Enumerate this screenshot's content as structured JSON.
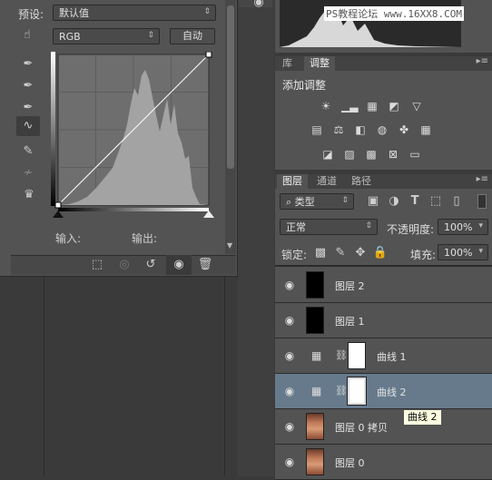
{
  "properties": {
    "preset_label": "预设:",
    "preset_value": "默认值",
    "channel_value": "RGB",
    "auto_button": "自动",
    "input_label": "输入:",
    "output_label": "输出:"
  },
  "histogram": {
    "watermark": "PS教程论坛 www.16XX8.COM"
  },
  "adjust_panel": {
    "tabs": [
      "库",
      "调整"
    ],
    "title": "添加调整"
  },
  "layers_panel": {
    "tabs": [
      "图层",
      "通道",
      "路径"
    ],
    "filter_kind": "类型",
    "blend_mode": "正常",
    "opacity_label": "不透明度:",
    "opacity_value": "100%",
    "lock_label": "锁定:",
    "fill_label": "填充:",
    "fill_value": "100%",
    "layers": [
      {
        "name": "图层 2",
        "type": "black"
      },
      {
        "name": "图层 1",
        "type": "black"
      },
      {
        "name": "曲线 1",
        "type": "curves"
      },
      {
        "name": "曲线 2",
        "type": "curves",
        "selected": true
      },
      {
        "name": "图层 0 拷贝",
        "type": "photo"
      },
      {
        "name": "图层 0",
        "type": "photo"
      }
    ],
    "tooltip": "曲线 2"
  },
  "colors": {
    "panel_bg": "#535353",
    "selected_row": "#667a8c",
    "graph_bg": "#6e6e6e"
  }
}
